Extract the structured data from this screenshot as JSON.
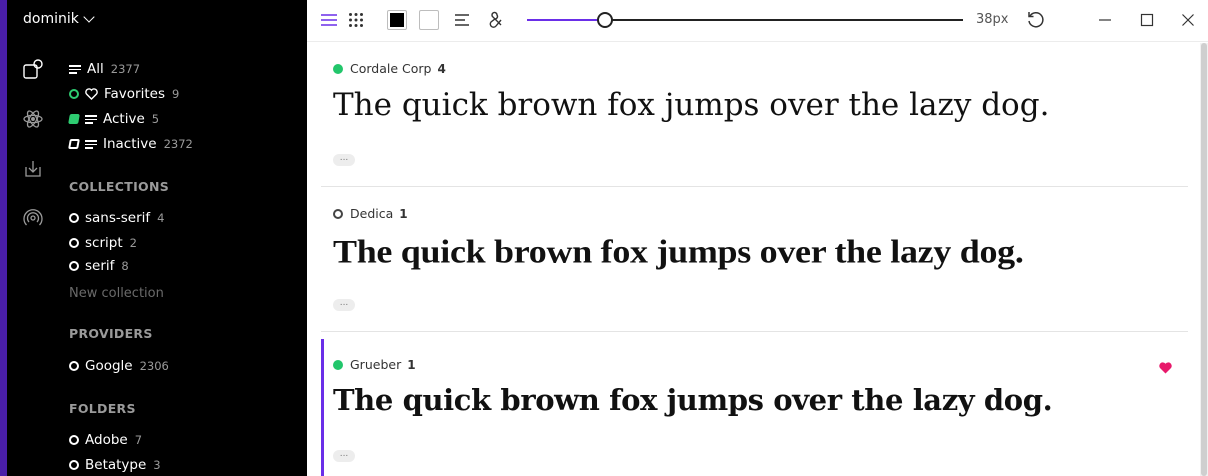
{
  "user": {
    "name": "dominik"
  },
  "library": [
    {
      "label": "All",
      "count": "2377"
    },
    {
      "label": "Favorites",
      "count": "9"
    },
    {
      "label": "Active",
      "count": "5"
    },
    {
      "label": "Inactive",
      "count": "2372"
    }
  ],
  "collections": {
    "heading": "COLLECTIONS",
    "items": [
      {
        "label": "sans-serif",
        "count": "4"
      },
      {
        "label": "script",
        "count": "2"
      },
      {
        "label": "serif",
        "count": "8"
      }
    ],
    "new_placeholder": "New collection"
  },
  "providers": {
    "heading": "PROVIDERS",
    "items": [
      {
        "label": "Google",
        "count": "2306"
      }
    ]
  },
  "folders": {
    "heading": "FOLDERS",
    "items": [
      {
        "label": "Adobe",
        "count": "7"
      },
      {
        "label": "Betatype",
        "count": "3"
      }
    ]
  },
  "toolbar": {
    "size_label": "38px",
    "slider_fraction": 0.18,
    "fg_color": "#000000",
    "bg_color": "#ffffff"
  },
  "fonts": [
    {
      "name": "Cordale Corp",
      "count": "4",
      "active": true,
      "favorite": false,
      "sample": "The quick brown fox jumps over the lazy dog."
    },
    {
      "name": "Dedica",
      "count": "1",
      "active": false,
      "favorite": false,
      "sample": "The quick brown fox jumps over the lazy dog."
    },
    {
      "name": "Grueber",
      "count": "1",
      "active": true,
      "favorite": true,
      "sample": "The quick brown fox jumps over the lazy dog."
    }
  ],
  "more_label": "...",
  "colors": {
    "accent": "#6a2ee8",
    "active_green": "#22c66b",
    "favorite": "#e8196b"
  }
}
